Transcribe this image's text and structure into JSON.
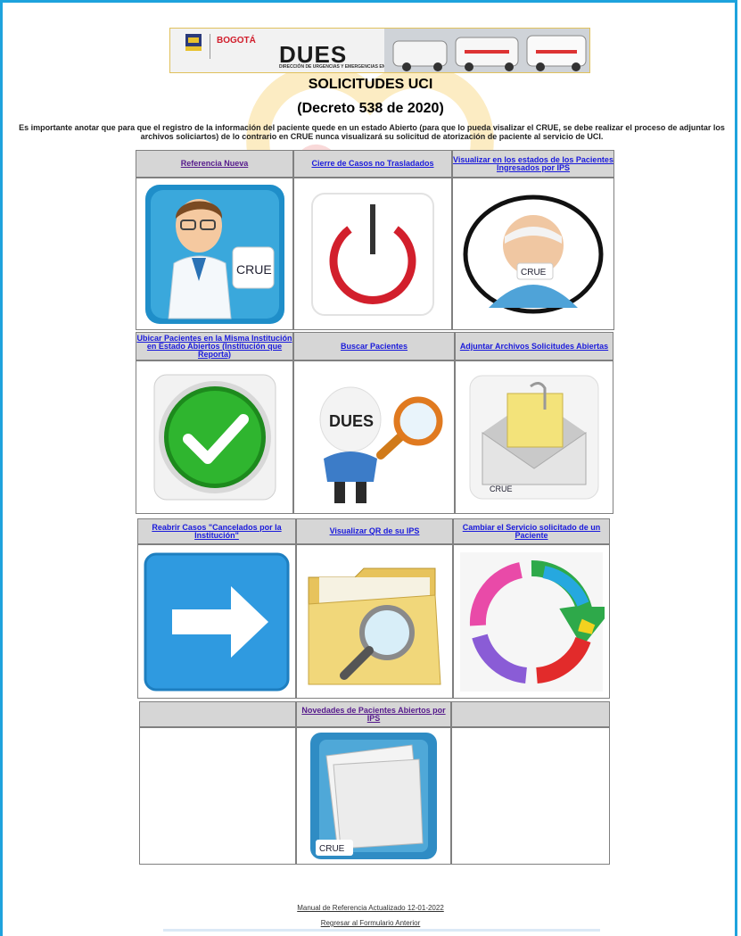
{
  "banner": {
    "city": "BOGOTÁ",
    "brand": "DUES",
    "subtitle": "DIRECCIÓN DE URGENCIAS Y EMERGENCIAS EN SALUD"
  },
  "page": {
    "title": "SOLICITUDES UCI",
    "decree": "(Decreto 538 de 2020)",
    "notice": "Es importante anotar que para que el registro de la información del paciente quede en un estado Abierto (para que lo pueda visalizar el CRUE, se debe realizar el proceso de adjuntar los archivos soliciartos) de lo contrario en CRUE nunca visualizará su solicitud de atorización de paciente al servicio de UCI."
  },
  "grid": {
    "row1": [
      {
        "label": "Referencia Nueva",
        "icon": "doctor-icon",
        "crue": "CRUE"
      },
      {
        "label": "Cierre de Casos no Trasladados",
        "icon": "power-icon"
      },
      {
        "label": "Visualizar en los estados de los Pacientes Ingresados por IPS",
        "icon": "patient-icon",
        "crue": "CRUE"
      }
    ],
    "row2": [
      {
        "label": "Ubicar Pacientes en la Misma Institución en Estado Abiertos (Institución que Reporta)",
        "icon": "check-icon"
      },
      {
        "label": "Buscar Pacientes",
        "icon": "search-person-icon",
        "dues": "DUES"
      },
      {
        "label": "Adjuntar Archivos Solicitudes Abiertas",
        "icon": "mail-attach-icon",
        "crue": "CRUE"
      }
    ],
    "row3": [
      {
        "label": "Reabrir Casos \"Cancelados por la Institución\"",
        "icon": "arrow-right-icon"
      },
      {
        "label": "Visualizar QR de su IPS",
        "icon": "folder-search-icon"
      },
      {
        "label": "Cambiar el Servicio solicitado de un Paciente",
        "icon": "cycle-arrows-icon"
      }
    ],
    "row4": [
      {
        "label": ""
      },
      {
        "label": "Novedades de Pacientes Abiertos por IPS",
        "icon": "documents-icon",
        "crue": "CRUE"
      },
      {
        "label": ""
      }
    ]
  },
  "footer": {
    "manual": "Manual de Referencia Actualizado 12-01-2022",
    "back": "Regresar al Formulario Anterior"
  },
  "colors": {
    "frame": "#1ea3dd",
    "header_bg": "#d6d6d6",
    "link": "#1a1adb",
    "visited_link": "#551a8b"
  }
}
